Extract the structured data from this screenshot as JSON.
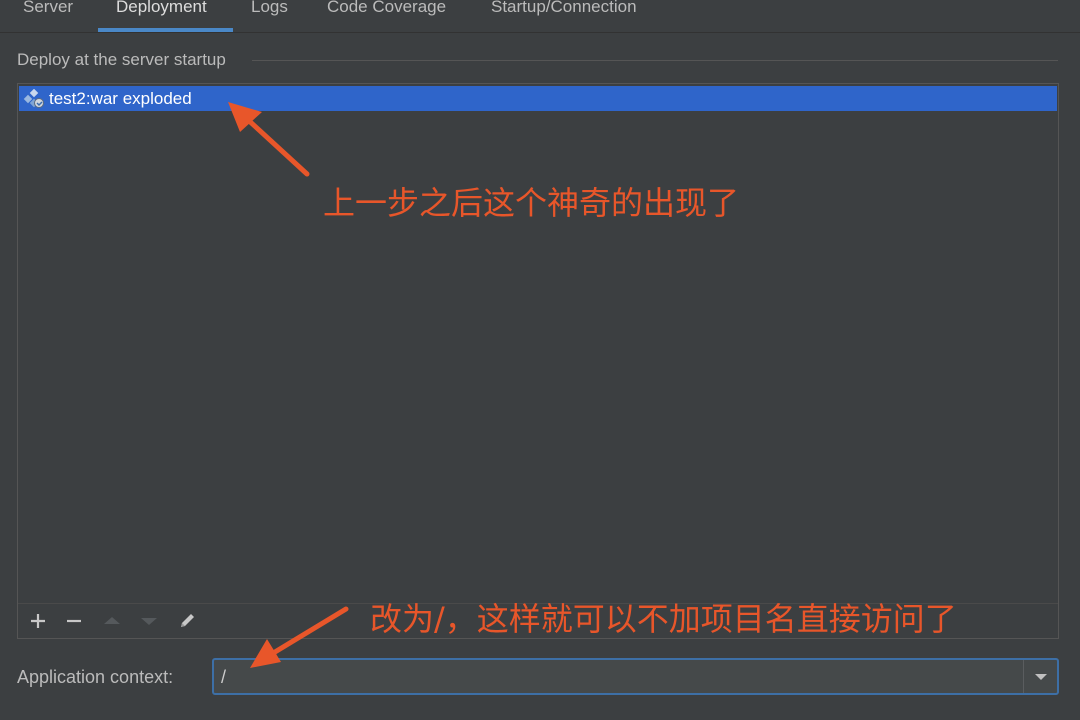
{
  "tabs": [
    {
      "label": "Server"
    },
    {
      "label": "Deployment"
    },
    {
      "label": "Logs"
    },
    {
      "label": "Code Coverage"
    },
    {
      "label": "Startup/Connection"
    }
  ],
  "active_tab": "Deployment",
  "deploy_section": {
    "title": "Deploy at the server startup",
    "items": [
      {
        "label": "test2:war exploded",
        "icon": "artifact-icon",
        "selected": true
      }
    ],
    "toolbar": [
      {
        "name": "add-icon",
        "glyph": "+"
      },
      {
        "name": "remove-icon",
        "glyph": "−"
      },
      {
        "name": "move-up-icon",
        "glyph": "▲"
      },
      {
        "name": "move-down-icon",
        "glyph": "▼"
      },
      {
        "name": "edit-icon",
        "glyph": "✎"
      }
    ]
  },
  "application_context": {
    "label": "Application context:",
    "value": "/"
  },
  "annotations": {
    "top": "上一步之后这个神奇的出现了",
    "bottom": "改为/，这样就可以不加项目名直接访问了"
  },
  "colors": {
    "background": "#3c3f41",
    "selection": "#2f65ca",
    "accent": "#4a88c7",
    "annotation": "#e8562a"
  }
}
